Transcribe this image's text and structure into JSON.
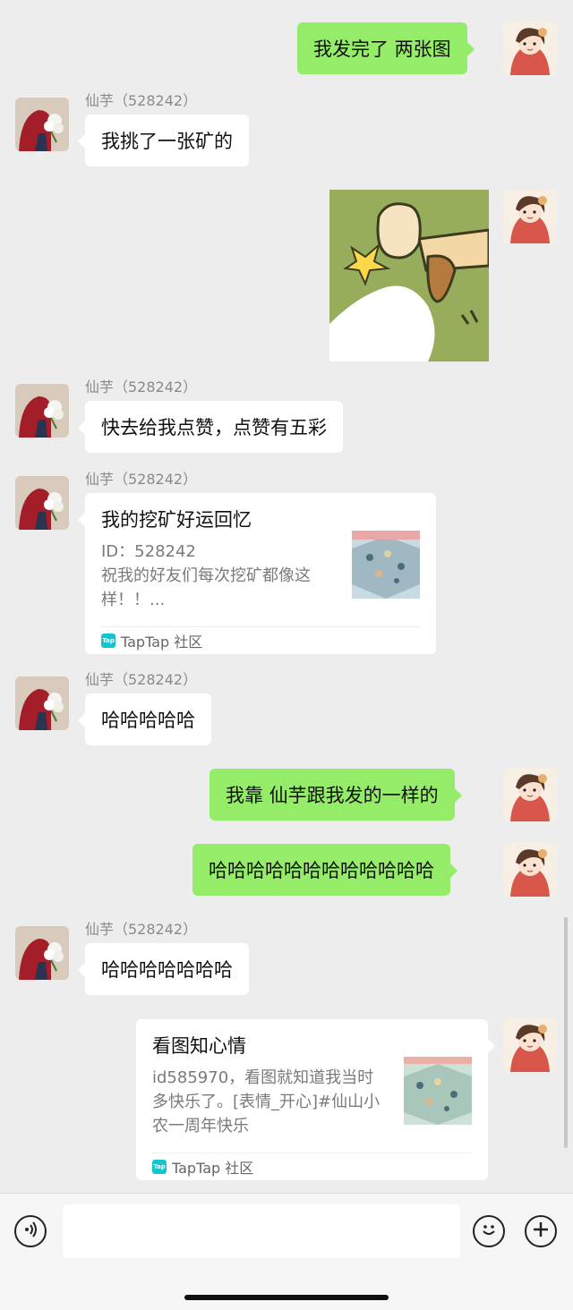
{
  "contact": {
    "name": "仙芋（528242）"
  },
  "messages": {
    "m1": {
      "text": "我发完了 两张图"
    },
    "m2": {
      "text": "我挑了一张矿的"
    },
    "m4": {
      "text": "快去给我点赞，点赞有五彩"
    },
    "m5": {
      "title": "我的挖矿好运回忆",
      "desc": "ID：528242\n祝我的好友们每次挖矿都像这样！！...",
      "source": "TapTap 社区"
    },
    "m6": {
      "text": "哈哈哈哈哈"
    },
    "m7": {
      "text": "我靠 仙芋跟我发的一样的"
    },
    "m8": {
      "text": "哈哈哈哈哈哈哈哈哈哈哈哈"
    },
    "m9": {
      "text": "哈哈哈哈哈哈哈"
    },
    "m10": {
      "title": "看图知心情",
      "desc": "id585970，看图就知道我当时多快乐了。[表情_开心]#仙山小农一周年快乐",
      "source": "TapTap 社区"
    }
  },
  "taptap_logo_text": "Tap",
  "colors": {
    "self_bubble": "#95ec69",
    "other_bubble": "#ffffff",
    "background": "#ededed",
    "taptap": "#15c5ce"
  },
  "icons": {
    "voice": "voice-icon",
    "emoji": "emoji-icon",
    "plus": "plus-icon"
  }
}
